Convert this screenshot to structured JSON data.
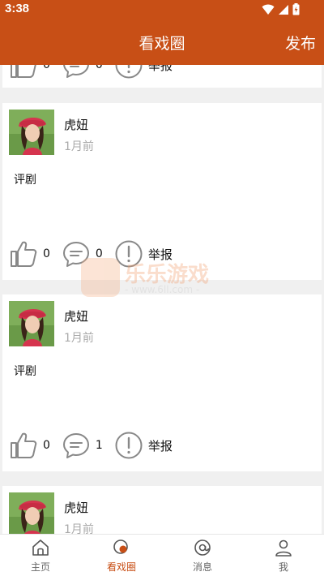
{
  "status_bar": {
    "time": "3:38"
  },
  "app_bar": {
    "title": "看戏圈",
    "publish_label": "发布"
  },
  "posts": [
    {
      "username": "",
      "time": "",
      "content": "",
      "likes": "0",
      "comments": "0",
      "report_label": "举报"
    },
    {
      "username": "虎妞",
      "time": "1月前",
      "content": "评剧",
      "likes": "0",
      "comments": "0",
      "report_label": "举报"
    },
    {
      "username": "虎妞",
      "time": "1月前",
      "content": "评剧",
      "likes": "0",
      "comments": "1",
      "report_label": "举报"
    },
    {
      "username": "虎妞",
      "time": "1月前",
      "content": "",
      "likes": "",
      "comments": "",
      "report_label": ""
    }
  ],
  "watermark": {
    "title": "乐乐游戏",
    "url": "- www.6ll.com -"
  },
  "bottom_nav": {
    "items": [
      {
        "label": "主页",
        "icon": "home-icon"
      },
      {
        "label": "看戏圈",
        "icon": "drama-circle-icon"
      },
      {
        "label": "消息",
        "icon": "at-icon"
      },
      {
        "label": "我",
        "icon": "person-icon"
      }
    ],
    "active_index": 1
  },
  "colors": {
    "brand": "#c84f16",
    "background": "#f0f0f0",
    "muted_text": "#aaaaaa"
  }
}
